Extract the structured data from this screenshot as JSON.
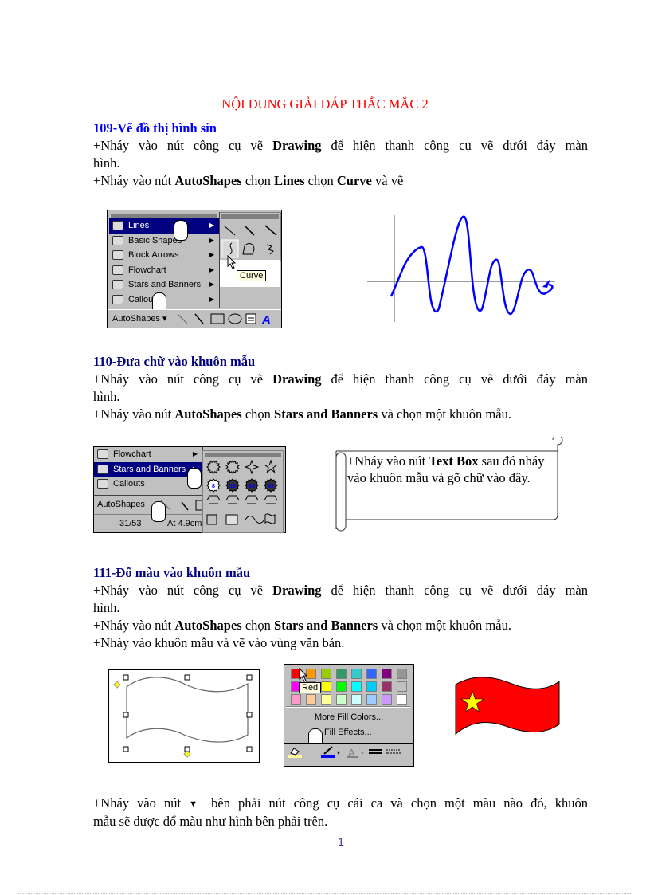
{
  "document": {
    "title": "NỘI DUNG GIẢI ĐÁP THẮC MẮC 2",
    "page_number": "1",
    "colors": {
      "title": "#ff0000",
      "heading_109": "#0000ff",
      "heading_other": "#000080",
      "page_number": "#333399"
    }
  },
  "sections": [
    {
      "heading": "109-Vẽ đồ thị hình sin",
      "p1": {
        "a": "+Nháy vào nút công cụ vẽ ",
        "b": "Drawing",
        "c": " để hiện thanh công cụ vẽ dưới đáy màn",
        "d": "hình."
      },
      "p2": {
        "a": "+Nháy vào nút ",
        "b": "AutoShapes",
        "c": " chọn ",
        "d": "Lines",
        "e": " chọn ",
        "f": "Curve",
        "g": " và vẽ"
      },
      "figure_menu": {
        "items": [
          "Lines",
          "Basic Shapes",
          "Block Arrows",
          "Flowchart",
          "Stars and Banners",
          "Callouts"
        ],
        "selected": "Lines",
        "tooltip": "Curve",
        "toolbar_label": "AutoShapes",
        "icons": [
          "line-icon",
          "arrow-icon",
          "rectangle-icon",
          "oval-icon",
          "text-box-icon",
          "wordart-icon"
        ]
      },
      "figure_graph": {
        "description": "sine-like damped curve drawn with Curve tool",
        "line_color": "#0000ff"
      }
    },
    {
      "heading": "110-Đưa chữ vào khuôn mẫu",
      "p1": {
        "a": "+Nháy vào nút công cụ vẽ ",
        "b": "Drawing",
        "c": " để hiện thanh công cụ vẽ dưới đáy màn",
        "d": "hình."
      },
      "p2": {
        "a": "+Nháy vào nút ",
        "b": "AutoShapes",
        "c": " chọn ",
        "d": "Stars and Banners",
        "e": " và chọn một khuôn mẫu."
      },
      "figure_menu": {
        "items": [
          "Flowchart",
          "Stars and Banners",
          "Callouts"
        ],
        "selected": "Stars and Banners",
        "toolbar_label": "AutoShapes",
        "status": {
          "page": "31/53",
          "at": "At 4.9cm"
        },
        "star_labels": [
          "8",
          "16",
          "24",
          "32"
        ]
      },
      "scroll_text": {
        "a": "+Nháy vào nút ",
        "b": "Text Box",
        "c": " sau đó nháy vào khuôn mẫu và gõ chữ vào đây."
      }
    },
    {
      "heading": "111-Đổ màu vào khuôn mẫu",
      "p1": {
        "a": "+Nháy vào nút công cụ vẽ ",
        "b": "Drawing",
        "c": " để hiện thanh công cụ vẽ dưới đáy màn",
        "d": "hình."
      },
      "p2": {
        "a": "+Nháy vào nút ",
        "b": "AutoShapes",
        "c": " chọn ",
        "d": "Stars and Banners",
        "e": " và chọn một khuôn mẫu."
      },
      "p3": "+Nháy vào khuôn mẫu và vẽ vào vùng văn bản.",
      "palette": {
        "tooltip": "Red",
        "more_colors": "More Fill Colors...",
        "fill_effects": "Fill Effects...",
        "rows": [
          [
            "#ff0000",
            "#ff9900",
            "#99cc00",
            "#339966",
            "#33cccc",
            "#3366ff",
            "#800080",
            "#969696"
          ],
          [
            "#ff00ff",
            "#ffcc00",
            "#ffff00",
            "#00ff00",
            "#00ffff",
            "#00ccff",
            "#993366",
            "#c0c0c0"
          ],
          [
            "#ff99cc",
            "#ffcc99",
            "#ffff99",
            "#ccffcc",
            "#ccffff",
            "#99ccff",
            "#cc99ff",
            "#ffffff"
          ]
        ]
      },
      "flag": {
        "fill": "#ff0000",
        "star": "#ffff00"
      },
      "p4": {
        "a": "+Nháy vào nút ",
        "b": " bên phải nút công cụ cái ca và chọn một màu nào đó, khuôn",
        "c": "mẫu sẽ được đổ màu như hình bên phải trên."
      }
    }
  ]
}
